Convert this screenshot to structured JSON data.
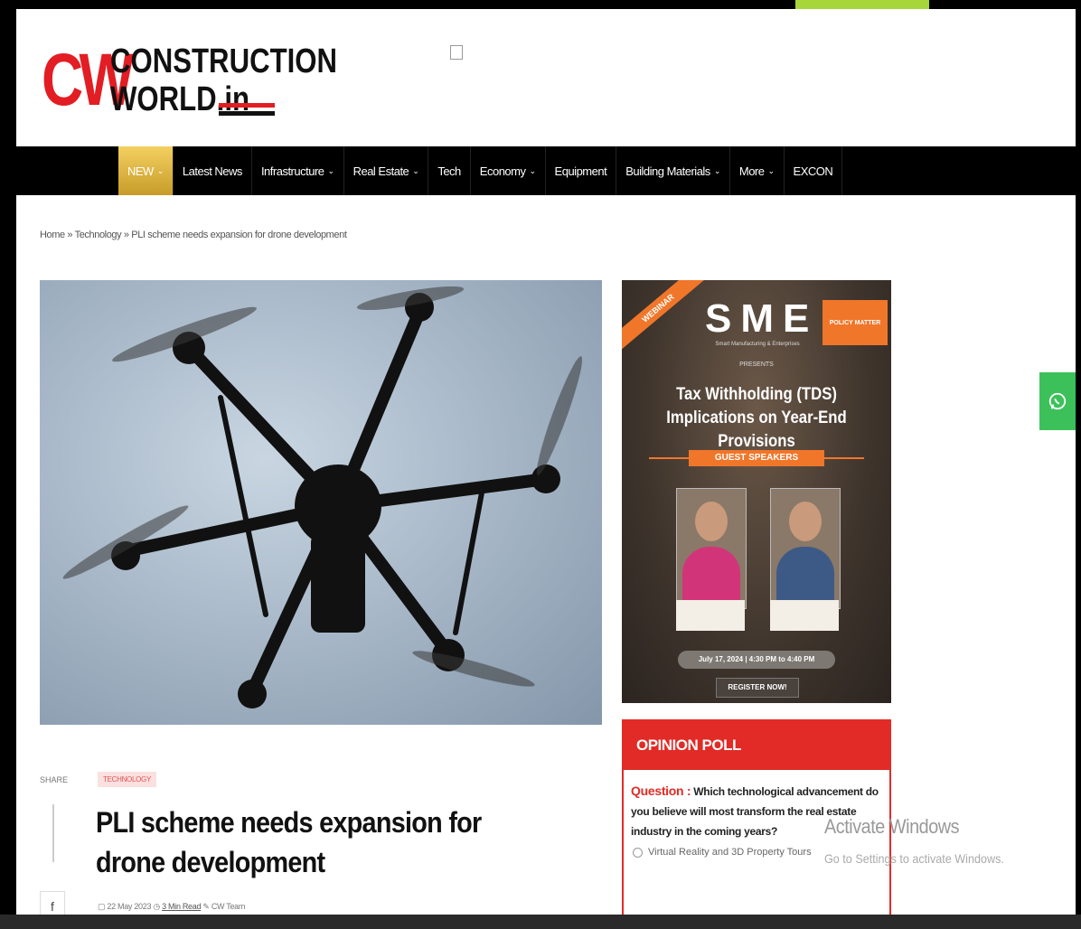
{
  "header": {
    "logo": {
      "mark": "CW",
      "line1": "CONSTRUCTION",
      "line2": "WORLD.in"
    },
    "colors": {
      "brand_red": "#e21d24",
      "nav_bg": "#000000",
      "new_gold": "#d9b23f",
      "whatsapp_green": "#3cc15a"
    }
  },
  "nav": {
    "items": [
      {
        "label": "NEW",
        "dropdown": true
      },
      {
        "label": "Latest News",
        "dropdown": false
      },
      {
        "label": "Infrastructure",
        "dropdown": true
      },
      {
        "label": "Real Estate",
        "dropdown": true
      },
      {
        "label": "Tech",
        "dropdown": false
      },
      {
        "label": "Economy",
        "dropdown": true
      },
      {
        "label": "Equipment",
        "dropdown": false
      },
      {
        "label": "Building Materials",
        "dropdown": true
      },
      {
        "label": "More",
        "dropdown": true
      },
      {
        "label": "EXCON",
        "dropdown": false
      }
    ]
  },
  "breadcrumb": {
    "home": "Home",
    "section": "Technology",
    "current": "PLI scheme needs expansion for drone development",
    "sep": "»"
  },
  "article": {
    "share_label": "SHARE",
    "category": "TECHNOLOGY",
    "title": "PLI scheme needs expansion for drone development",
    "meta": {
      "date": "22 May 2023",
      "read_time": "3 Min Read",
      "author": "CW Team"
    },
    "facebook_icon": "f"
  },
  "ad": {
    "ribbon": "WEBINAR",
    "brand": "SME",
    "brand_tag": "POLICY MATTER",
    "brand_sub": "Smart Manufacturing & Enterprises",
    "presents": "PRESENTS",
    "headline": "Tax Withholding (TDS) Implications on Year-End Provisions",
    "guest_label": "GUEST SPEAKERS",
    "date": "July 17, 2024 | 4:30 PM to 4:40 PM",
    "register": "REGISTER NOW!"
  },
  "poll": {
    "title": "OPINION POLL",
    "question_label": "Question :",
    "question": "Which technological advancement do you believe will most transform the real estate industry in the coming years?",
    "options": [
      "Virtual Reality and 3D Property Tours"
    ]
  },
  "overlay": {
    "activate_title": "Activate Windows",
    "activate_sub": "Go to Settings to activate Windows."
  }
}
